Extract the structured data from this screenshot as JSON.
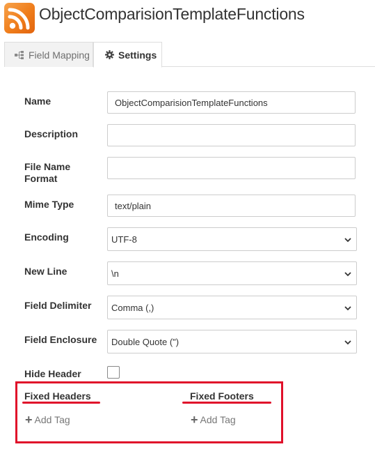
{
  "app": {
    "title": "ObjectComparisionTemplateFunctions",
    "logo_icon": "rss-feed-icon",
    "logo_color": "#ef7d1b"
  },
  "tabs": [
    {
      "label": "Field Mapping",
      "icon": "sitemap-icon",
      "active": false
    },
    {
      "label": "Settings",
      "icon": "gear-icon",
      "active": true
    }
  ],
  "form": {
    "name": {
      "label": "Name",
      "value": "ObjectComparisionTemplateFunctions"
    },
    "description": {
      "label": "Description",
      "value": ""
    },
    "file_name_format": {
      "label_line1": "File Name",
      "label_line2": "Format",
      "value": ""
    },
    "mime_type": {
      "label": "Mime Type",
      "value": "text/plain"
    },
    "encoding": {
      "label": "Encoding",
      "value": "UTF-8"
    },
    "new_line": {
      "label": "New Line",
      "value": "\\n"
    },
    "field_delimiter": {
      "label": "Field Delimiter",
      "value": "Comma (,)"
    },
    "field_enclosure": {
      "label": "Field Enclosure",
      "value": "Double Quote (\")"
    },
    "hide_header": {
      "label": "Hide Header",
      "checked": false
    }
  },
  "fixed_headers": {
    "title": "Fixed Headers",
    "add_label": "Add Tag"
  },
  "fixed_footers": {
    "title": "Fixed Footers",
    "add_label": "Add Tag"
  },
  "annotation_color": "#e0102a"
}
